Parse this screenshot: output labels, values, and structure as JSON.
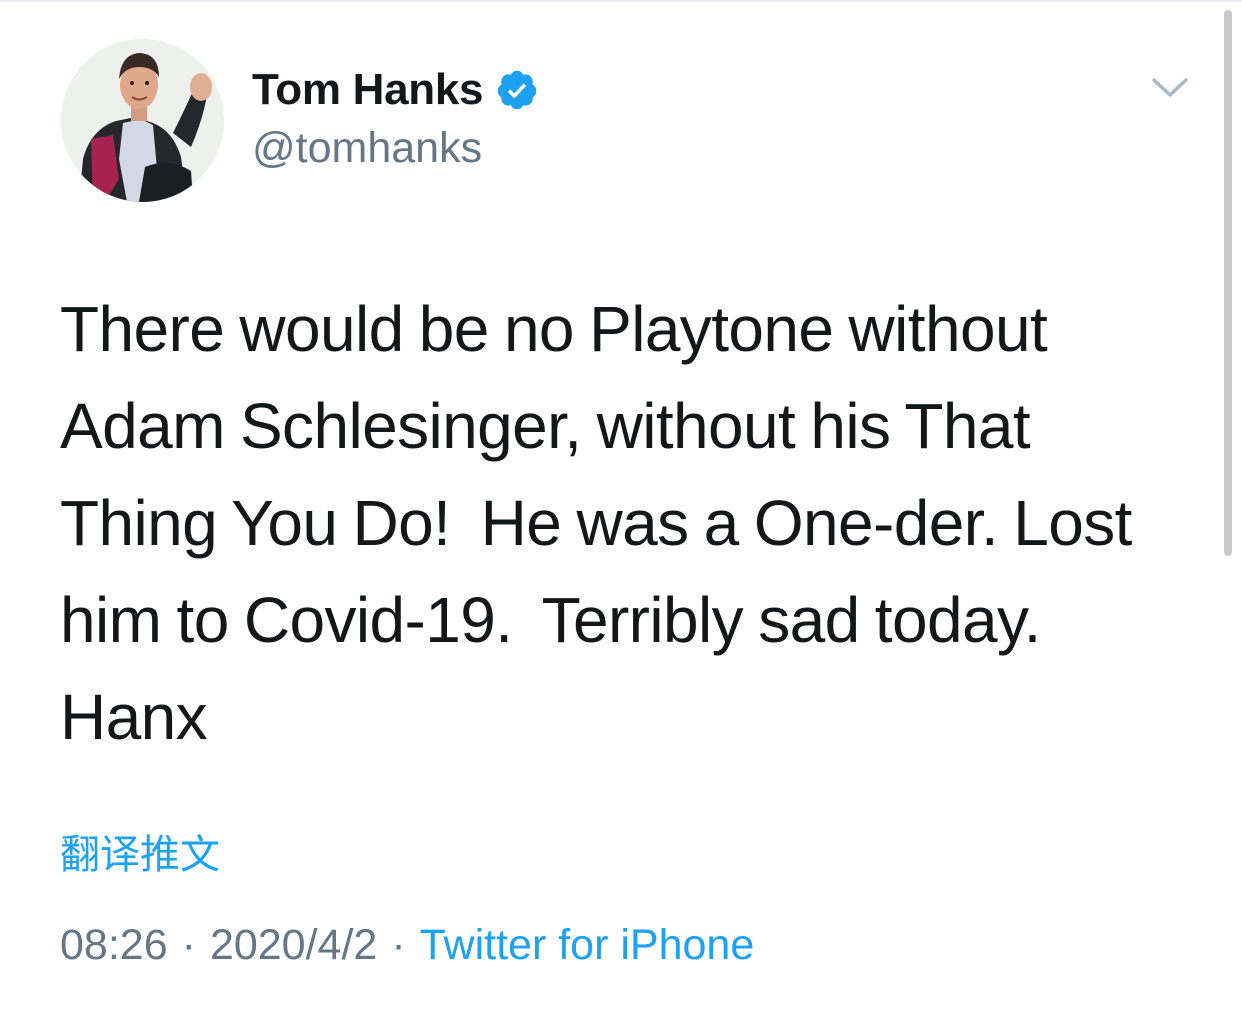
{
  "author": {
    "display_name": "Tom Hanks",
    "handle": "@tomhanks",
    "verified": true
  },
  "tweet": {
    "lines": [
      "There would be no Playtone without",
      "Adam Schlesinger, without his That",
      "Thing You Do!  He was a One-der. Lost",
      "him to Covid-19.  Terribly sad today.",
      "Hanx"
    ],
    "translate_label": "翻译推文",
    "time": "08:26",
    "date": "2020/4/2",
    "separator": "·",
    "source": "Twitter for iPhone"
  },
  "icons": {
    "verified": "verified-badge-icon",
    "menu": "chevron-down-icon"
  },
  "colors": {
    "text": "#14171a",
    "secondary": "#657786",
    "accent": "#1da1f2"
  }
}
